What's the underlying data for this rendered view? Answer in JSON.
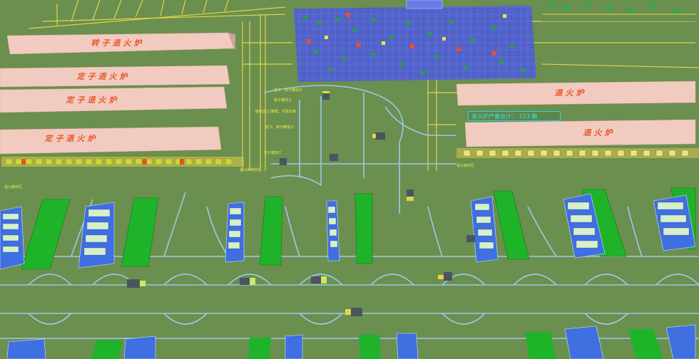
{
  "scene": {
    "ground_color": "#6b8f4e",
    "track_color": "#9cc9e8",
    "rail_color": "#e3d54a",
    "rack_color": "#3f6fe0",
    "pad_color": "#1fb32a",
    "furnace_color": "#f2cbc0",
    "furnace_label_color": "#e8572a"
  },
  "furnaces": {
    "rotor": "转子退火炉",
    "stator_1": "定子退火炉",
    "stator_2": "定子退火炉",
    "stator_3": "定子退火炉",
    "annealing_1": "退火炉",
    "annealing_2": "退火炉"
  },
  "counter": {
    "text": "退火炉产量总计： 123 箱"
  },
  "small_labels": {
    "rail_a": "定子、转子精加工",
    "rail_b": "转子精加工",
    "rail_c": "缓存区(1)箱框、并发出库",
    "rail_d": "定子、转子精加工",
    "rail_e": "定子精加工",
    "rail_f": "退火炉缓存区",
    "rail_g": "退火缓存区",
    "rail_h": "退火缓存区"
  }
}
